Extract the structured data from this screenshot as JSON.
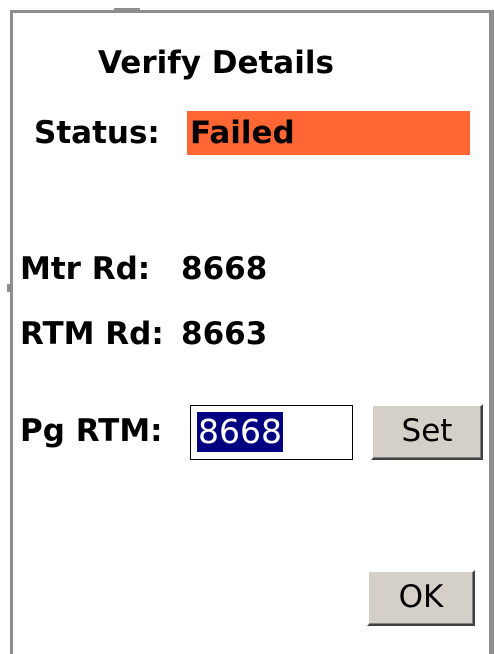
{
  "dialog": {
    "title": "Verify Details",
    "status_label": "Status:",
    "status_value": "Failed",
    "status_color": "#ff6633",
    "meter_read_label": "Mtr Rd:",
    "meter_read_value": "8668",
    "rtm_read_label": "RTM Rd:",
    "rtm_read_value": "8663",
    "pg_rtm_label": "Pg RTM:",
    "pg_rtm_value": "8668",
    "set_label": "Set",
    "ok_label": "OK"
  }
}
